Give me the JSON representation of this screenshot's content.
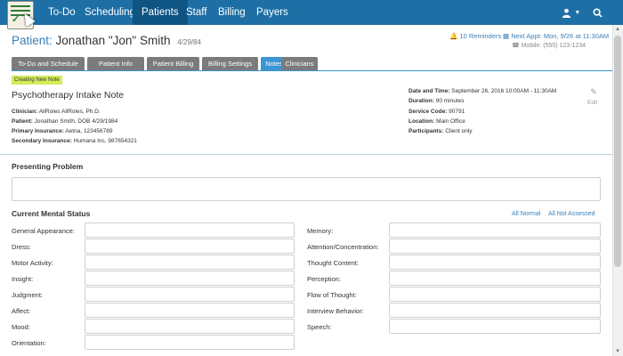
{
  "nav": {
    "items": [
      "To-Do",
      "Scheduling",
      "Patients",
      "Staff",
      "Billing",
      "Payers"
    ],
    "active": "Patients",
    "user_icon": "user-icon",
    "search_icon": "search-icon",
    "colors": {
      "bar": "#1d6fa5",
      "active": "#0f5584"
    }
  },
  "patient": {
    "label": "Patient:",
    "name": "Jonathan \"Jon\" Smith",
    "dob": "4/29/84",
    "reminders": "10 Reminders",
    "next_appt": "Next Appt: Mon, 9/26 at 11:30AM",
    "mobile": "Mobile: (555) 123-1234"
  },
  "tabs": [
    "To-Do and Schedule",
    "Patient Info",
    "Patient Billing",
    "Billing Settings",
    "Notes",
    "Clinicians"
  ],
  "active_tab": "Notes",
  "note": {
    "badge": "Creating New Note",
    "title": "Psychotherapy Intake Note",
    "left": [
      {
        "label": "Clinician:",
        "value": "AllRoles AllRoles, Ph.D."
      },
      {
        "label": "Patient:",
        "value": "Jonathan Smith, DOB 4/29/1984"
      },
      {
        "label": "Primary Insurance:",
        "value": "Aetna, 123456789"
      },
      {
        "label": "Secondary Insurance:",
        "value": "Humana Inc, 987654321"
      }
    ],
    "right": [
      {
        "label": "Date and Time:",
        "value": "September 26, 2016 10:00AM - 11:30AM"
      },
      {
        "label": "Duration:",
        "value": "90 minutes"
      },
      {
        "label": "Service Code:",
        "value": "90791"
      },
      {
        "label": "Location:",
        "value": "Main Office"
      },
      {
        "label": "Participants:",
        "value": "Client only"
      }
    ],
    "edit_label": "Edit"
  },
  "presenting_problem": {
    "title": "Presenting Problem",
    "value": ""
  },
  "mental_status": {
    "title": "Current Mental Status",
    "all_normal": "All Normal",
    "all_not_assessed": "All Not Assessed",
    "left_fields": [
      "General Appearance:",
      "Dress:",
      "Motor Activity:",
      "Insight:",
      "Judgment:",
      "Affect:",
      "Mood:",
      "Orientation:"
    ],
    "right_fields": [
      "Memory:",
      "Attention/Concentration:",
      "Thought Content:",
      "Perception:",
      "Flow of Thought:",
      "Interview Behavior:",
      "Speech:"
    ]
  }
}
